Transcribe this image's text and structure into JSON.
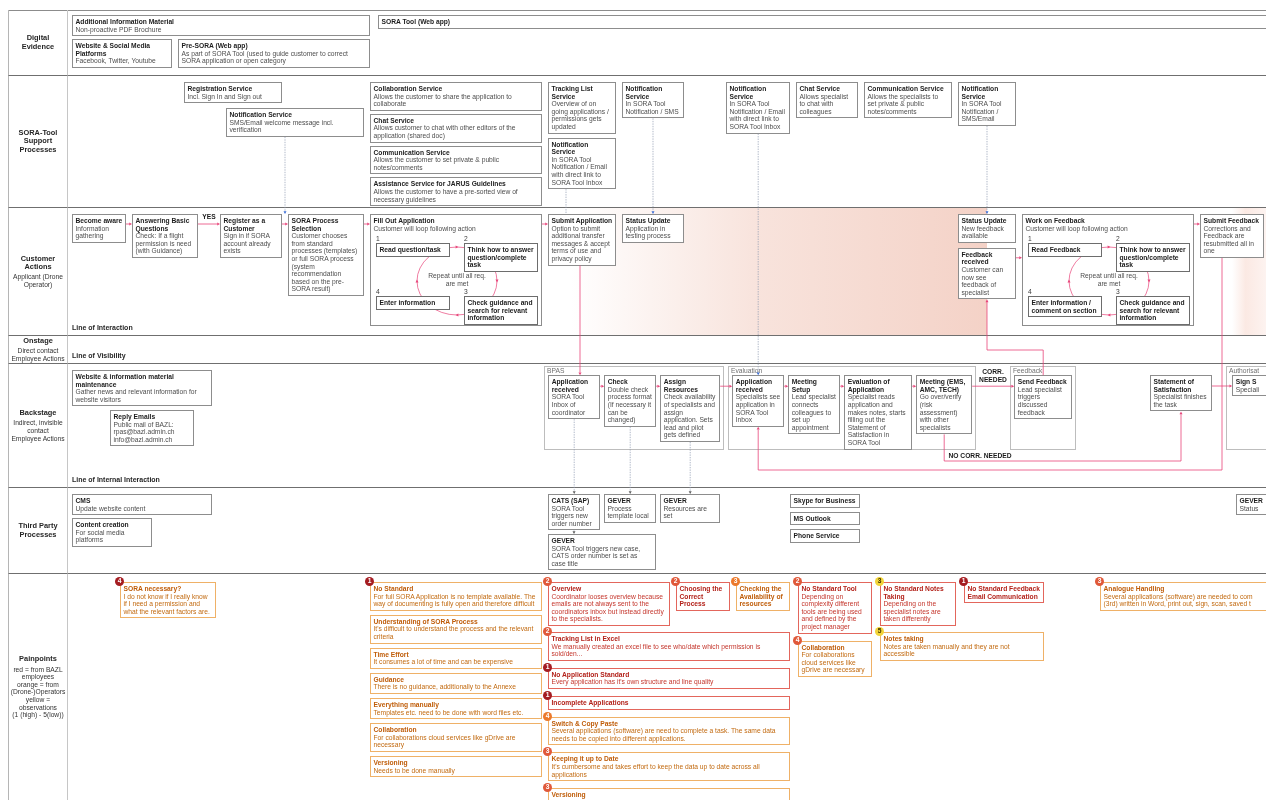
{
  "digital_evidence": {
    "title": "Digital Evidence",
    "cards": [
      {
        "title": "Additional Information Material",
        "text": "Non-proactive PDF Brochure"
      },
      {
        "title": "SORA Tool (Web app)"
      },
      {
        "title": "Website & Social Media Platforms",
        "text": "Facebook, Twitter, Youtube"
      },
      {
        "title": "Pre-SORA (Web app)",
        "text": "As part of SORA Tool (used to guide customer to correct SORA application or open category"
      }
    ]
  },
  "support_processes": {
    "title": "SORA-Tool\nSupport Processes",
    "cards": [
      {
        "title": "Registration Service",
        "text": "Incl. Sign In and Sign out"
      },
      {
        "title": "Notification Service",
        "text": "SMS/Email welcome message incl. verification"
      },
      {
        "title": "Collaboration Service",
        "text": "Allows the customer to share the application to collaborate"
      },
      {
        "title": "Chat Service",
        "text": "Allows customer to chat with other editors of the application (shared doc)"
      },
      {
        "title": "Communication Service",
        "text": "Allows the customer to set private & public notes/comments"
      },
      {
        "title": "Assistance Service for JARUS Guidelines",
        "text": "Allows the customer to have a pre-sorted view of necessary guidelines"
      },
      {
        "title": "Tracking List Service",
        "text": "Overview of on going applications / permissions gets updated"
      },
      {
        "title": "Notification Service",
        "text": "In SORA Tool Notification / Email with direct link to SORA Tool Inbox"
      },
      {
        "title": "Notification Service",
        "text": "In SORA Tool Notification / SMS"
      },
      {
        "title": "Notification Service",
        "text": "In SORA Tool Notification / Email with direct link to SORA Tool Inbox"
      },
      {
        "title": "Chat Service",
        "text": "Allows specialist to chat with colleagues"
      },
      {
        "title": "Communication Service",
        "text": "Allows the specialists to set private & public notes/comments"
      },
      {
        "title": "Notification Service",
        "text": "In SORA Tool Notification / SMS/Email"
      }
    ]
  },
  "customer_actions": {
    "title": "Customer Actions",
    "subtitle": "Applicant (Drone Operator)",
    "cards": [
      {
        "title": "Become aware",
        "text": "Information gathering"
      },
      {
        "title": "Answering Basic Questions",
        "text": "Check: If a flight permission is need (with Guidance)"
      },
      {
        "title": "Register as a Customer",
        "text": "Sign in if SORA account already exists"
      },
      {
        "title": "SORA Process Selection",
        "text": "Customer chooses from standard processes (templates) or full SORA process (system recommendation based on the pre-SORA result)"
      },
      {
        "title": "Submit Application",
        "text": "Option to submit additional transfer messages & accept terms of use and privacy policy"
      },
      {
        "title": "Status Update",
        "text": "Application in testing process"
      },
      {
        "title": "Status Update",
        "text": "New feedback available"
      },
      {
        "title": "Feedback received",
        "text": "Customer can now see feedback of specialist"
      },
      {
        "title": "Submit Feedback",
        "text": "Corrections and Feedback are resubmitted all in one"
      }
    ],
    "loops": [
      {
        "title": "Fill Out Application",
        "text": "Customer will loop following action",
        "steps": [
          {
            "number": "1",
            "label": "Read question/task"
          },
          {
            "number": "2",
            "label": "Think how to answer question/complete task"
          },
          {
            "number": "4",
            "label": "Enter information"
          },
          {
            "number": "3",
            "label": "Check guidance and search for relevant information"
          }
        ],
        "note": "Repeat until all req. are met"
      },
      {
        "title": "Work on Feedback",
        "text": "Customer will loop following action",
        "steps": [
          {
            "number": "1",
            "label": "Read Feedback"
          },
          {
            "number": "2",
            "label": "Think how to answer question/complete task"
          },
          {
            "number": "4",
            "label": "Enter information / comment on section"
          },
          {
            "number": "3",
            "label": "Check guidance and search for relevant information"
          }
        ],
        "note": "Repeat until all req. are met"
      }
    ],
    "decision_labels": [
      "YES"
    ],
    "line_label": "Line of Interaction"
  },
  "onstage": {
    "title": "Onstage",
    "subtitle": "Direct contact\nEmployee Actions",
    "line_label": "Line of Visibility"
  },
  "backstage": {
    "title": "Backstage",
    "subtitle": "Indirect, invisible contact\nEmployee Actions",
    "cards": [
      {
        "title": "Website & information material maintenance",
        "text": "Gather news and relevant information for website visitors"
      },
      {
        "title": "Reply Emails",
        "text": "Public mail of BAZL:\nrpas@bazl.admin.ch\ninfo@bazl.admin.ch"
      },
      {
        "title": "Statement of Satisfaction",
        "text": "Specialist finishes the task"
      }
    ],
    "groups": [
      {
        "label": "BPAS",
        "cards": [
          {
            "title": "Application received",
            "text": "SORA Tool Inbox of coordinator"
          },
          {
            "title": "Check",
            "text": "Double check process format (If necessary it can be changed)"
          },
          {
            "title": "Assign Resources",
            "text": "Check availability of specialists and assign application. Sets lead and pilot gets defined"
          }
        ]
      },
      {
        "label": "Evaluation",
        "cards": [
          {
            "title": "Application received",
            "text": "Specialists see application in SORA Tool Inbox"
          },
          {
            "title": "Meeting Setup",
            "text": "Lead specialist connects colleagues to set up appointment"
          },
          {
            "title": "Evaluation of Application",
            "text": "Specialist reads application and makes notes, starts filling out the Statement of Satisfaction in SORA Tool"
          },
          {
            "title": "Meeting (EMS, AMC, TECH)",
            "text": "Go over/verify (risk assessment) with other specialists"
          }
        ]
      },
      {
        "label": "Feedback",
        "cards": [
          {
            "title": "Send Feedback",
            "text": "Lead specialist triggers discussed feedback"
          }
        ]
      },
      {
        "label": "Authorisat",
        "cards": [
          {
            "title": "Sign S",
            "text": "Speciali"
          }
        ]
      }
    ],
    "decision_labels": [
      "CORR. NEEDED",
      "NO CORR. NEEDED"
    ],
    "line_label": "Line of Internal Interaction"
  },
  "third_party_processes": {
    "title": "Third Party\nProcesses",
    "cards": [
      {
        "title": "CMS",
        "text": "Update website content"
      },
      {
        "title": "Content creation",
        "text": "For social media platforms"
      },
      {
        "title": "CATS (SAP)",
        "text": "SORA Tool triggers new order number"
      },
      {
        "title": "GEVER",
        "text": "Process template local"
      },
      {
        "title": "GEVER",
        "text": "Resources are set"
      },
      {
        "title": "GEVER",
        "text": "SORA Tool triggers new case, CATS order number is set as case title"
      },
      {
        "title": "Skype for Business"
      },
      {
        "title": "MS Outlook"
      },
      {
        "title": "Phone Service"
      },
      {
        "title": "GEVER",
        "text": "Status"
      }
    ]
  },
  "pain_points": {
    "title": "Painpoints",
    "subtitle": "red = from BAZL employees\norange = from (Drone-)Operators\nyellow = observations\n(1 (high) - 5(low))",
    "items": [
      {
        "kind": "operator",
        "badge": "4",
        "color": "#a51d22",
        "title": "SORA necessary?",
        "text": "I do not know if I really know if I need a permission and what the relevant factors are."
      },
      {
        "kind": "operator",
        "badge": "1",
        "color": "#a51d22",
        "title": "No Standard",
        "text": "For full SORA Application is no template available. The way of documenting is fully open and therefore difficult"
      },
      {
        "kind": "operator",
        "title": "Understanding of SORA Process",
        "text": "It's difficult to understand the process and the relevant criteria"
      },
      {
        "kind": "operator",
        "title": "Time Effort",
        "text": "It consumes a lot of time and can be expensive"
      },
      {
        "kind": "operator",
        "title": "Guidance",
        "text": "There is no guidance, additionally to the Annexe"
      },
      {
        "kind": "operator",
        "title": "Everything manually",
        "text": "Templates etc. need to be done with word files etc."
      },
      {
        "kind": "operator",
        "title": "Collaboration",
        "text": "For collaborations cloud services like gDrive are necessary"
      },
      {
        "kind": "operator",
        "title": "Versioning",
        "text": "Needs to be done manually"
      },
      {
        "kind": "employee",
        "badge": "2",
        "color": "#e0593a",
        "title": "Overview",
        "text": "Coordinator looses overview because emails are not always sent to the coordinators inbox but instead directly to the specialists."
      },
      {
        "kind": "employee",
        "badge": "2",
        "color": "#e0593a",
        "title": "Tracking List in Excel",
        "text": "We manually created an excel file to see who/date which permission is sold/den..."
      },
      {
        "kind": "employee",
        "badge": "1",
        "color": "#a51d22",
        "title": "No Application Standard",
        "text": "Every application has it's own structure and line quality"
      },
      {
        "kind": "employee",
        "badge": "1",
        "color": "#a51d22",
        "title": "Incomplete Applications"
      },
      {
        "kind": "operator",
        "badge": "4",
        "color": "#ec7a2c",
        "title": "Switch & Copy Paste",
        "text": "Several applications (software) are need to complete a task. The same data needs to be copied into different applications."
      },
      {
        "kind": "operator",
        "badge": "3",
        "color": "#e0593a",
        "title": "Keeping it up to Date",
        "text": "It's cumbersome and takes effort to keep the data up to date across all applications"
      },
      {
        "kind": "operator",
        "badge": "3",
        "color": "#e0593a",
        "title": "Versioning"
      },
      {
        "kind": "employee",
        "badge": "2",
        "color": "#e0593a",
        "title": "Choosing the Correct Process"
      },
      {
        "kind": "operator",
        "badge": "3",
        "color": "#ec7a2c",
        "title": "Checking the Availability of resources"
      },
      {
        "kind": "employee",
        "badge": "2",
        "color": "#e0593a",
        "title": "No Standard Tool",
        "text": "Depending on complexity different tools are being used and defined by the project manager"
      },
      {
        "kind": "operator",
        "badge": "4",
        "color": "#e0593a",
        "title": "Collaboration",
        "text": "For collaborations cloud services like gDrive are necessary"
      },
      {
        "kind": "employee",
        "badge": "3",
        "color": "#f2d43a",
        "title": "No Standard Notes Taking",
        "text": "Depending on the specialist notes are taken differently"
      },
      {
        "kind": "operator",
        "badge": "5",
        "color": "#f2d43a",
        "title": "Notes taking",
        "text": "Notes are taken manually and they are not accessible"
      },
      {
        "kind": "employee",
        "badge": "1",
        "color": "#a51d22",
        "title": "No Standard Feedback Email Communication"
      },
      {
        "kind": "operator",
        "badge": "3",
        "color": "#e0593a",
        "title": "Analogue Handling",
        "text": "Several applications (software) are needed to com\n(3rd) written in Word, print out, sign, scan, saved t"
      }
    ]
  }
}
